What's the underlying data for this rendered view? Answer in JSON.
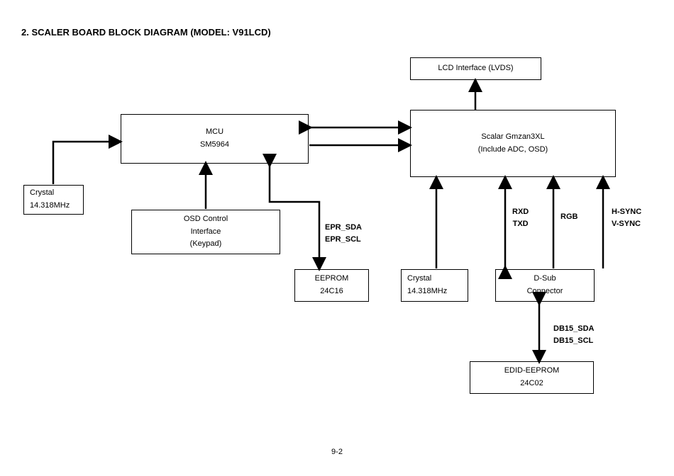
{
  "title": "2.  SCALER BOARD BLOCK DIAGRAM (MODEL: V91LCD)",
  "blocks": {
    "lcd": "LCD Interface (LVDS)",
    "mcu": {
      "l1": "MCU",
      "l2": "SM5964"
    },
    "scalar": {
      "l1": "Scalar Gmzan3XL",
      "l2": "(Include ADC, OSD)"
    },
    "crystal1": {
      "l1": "Crystal",
      "l2": "14.318MHz"
    },
    "osd": {
      "l1": "OSD Control",
      "l2": "Interface",
      "l3": "(Keypad)"
    },
    "eeprom": {
      "l1": "EEPROM",
      "l2": "24C16"
    },
    "crystal2": {
      "l1": "Crystal",
      "l2": "14.318MHz"
    },
    "dsub": {
      "l1": "D-Sub",
      "l2": "Connector"
    },
    "edid": {
      "l1": "EDID-EEPROM",
      "l2": "24C02"
    }
  },
  "signals": {
    "epr": {
      "l1": "EPR_SDA",
      "l2": "EPR_SCL"
    },
    "rxtx": {
      "l1": "RXD",
      "l2": "TXD"
    },
    "rgb": "RGB",
    "sync": {
      "l1": "H-SYNC",
      "l2": "V-SYNC"
    },
    "db15": {
      "l1": "DB15_SDA",
      "l2": "DB15_SCL"
    }
  },
  "page": "9-2"
}
